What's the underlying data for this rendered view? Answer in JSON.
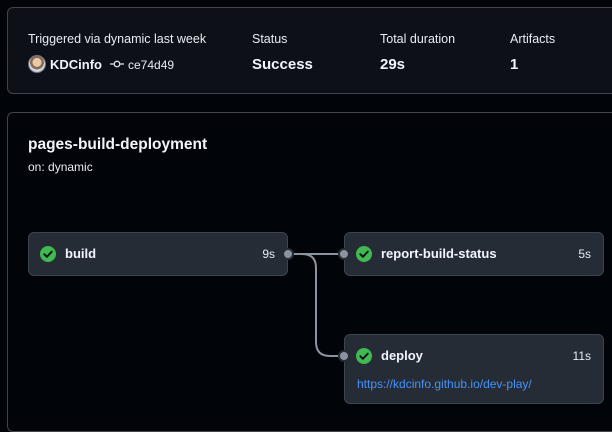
{
  "summary": {
    "trigger_label": "Triggered via dynamic last week",
    "actor": "KDCinfo",
    "commit": "ce74d49",
    "status_label": "Status",
    "status_value": "Success",
    "duration_label": "Total duration",
    "duration_value": "29s",
    "artifacts_label": "Artifacts",
    "artifacts_value": "1"
  },
  "workflow": {
    "title": "pages-build-deployment",
    "trigger": "on: dynamic",
    "jobs": [
      {
        "name": "build",
        "duration": "9s",
        "status": "success"
      },
      {
        "name": "report-build-status",
        "duration": "5s",
        "status": "success"
      },
      {
        "name": "deploy",
        "duration": "11s",
        "status": "success",
        "url": "https://kdcinfo.github.io/dev-play/"
      }
    ]
  },
  "colors": {
    "success": "#3fb950",
    "link": "#4493f8",
    "background": "#010409",
    "panel": "#0d1117",
    "job_box": "#262c36"
  },
  "icons": {
    "commit": "git-commit-icon",
    "success": "check-circle-fill-icon"
  }
}
